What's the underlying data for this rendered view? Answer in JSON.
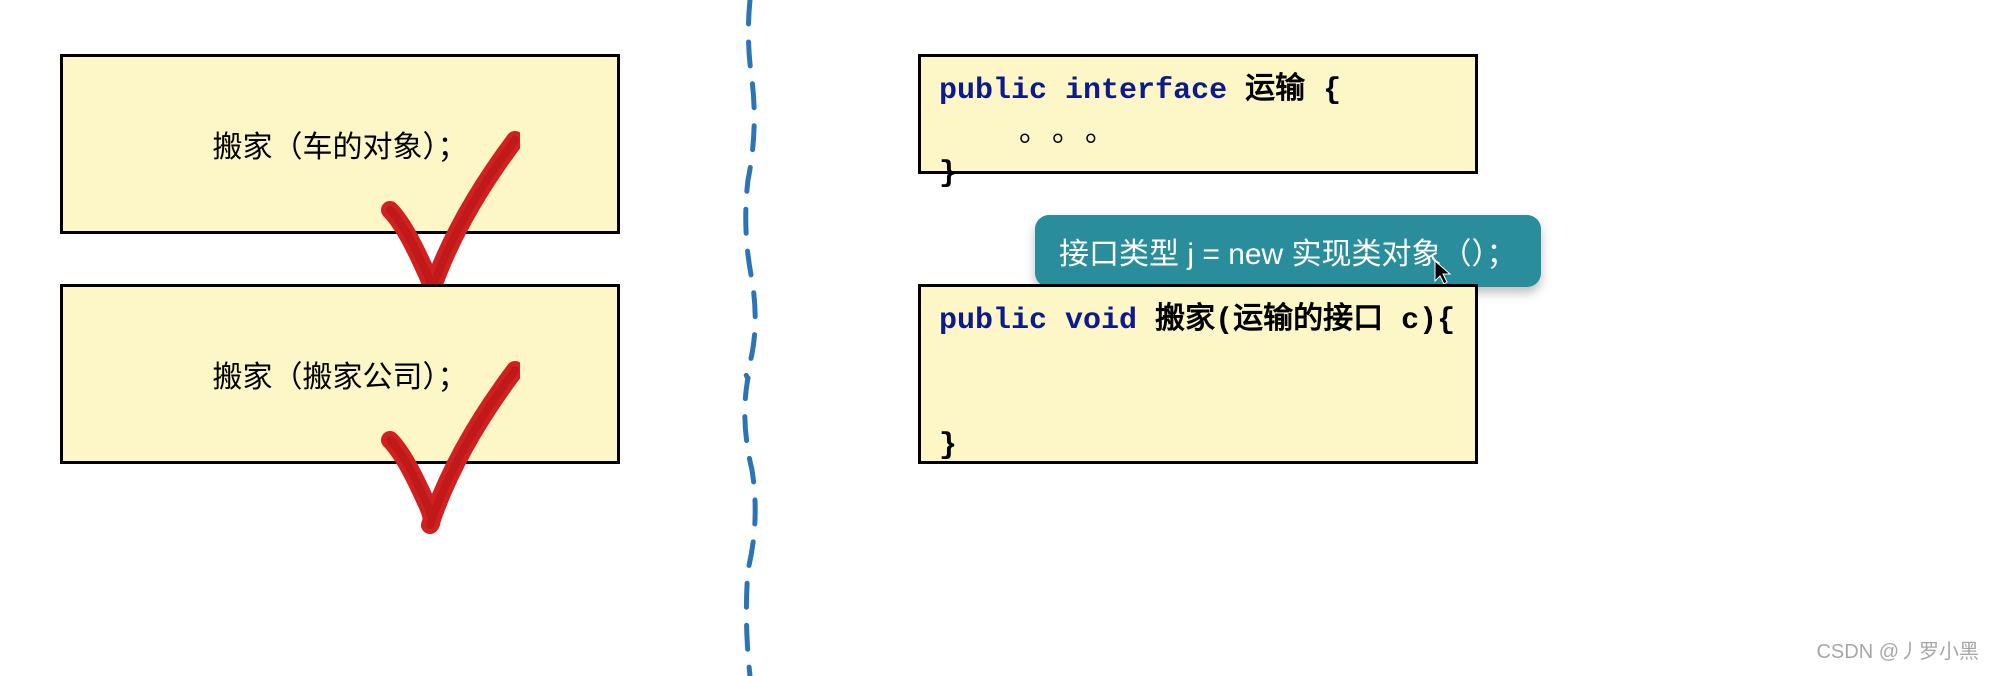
{
  "left": {
    "box1_text": "搬家（车的对象）；",
    "box2_text": "搬家（搬家公司）；"
  },
  "right": {
    "interface_decl_kw1": "public",
    "interface_decl_kw2": "interface",
    "interface_decl_name": "运输 {",
    "interface_dots": "。。。",
    "interface_close": "}",
    "method_decl_kw1": "public",
    "method_decl_kw2": "void",
    "method_decl_rest": "搬家(运输的接口 c){",
    "method_close": "}"
  },
  "label": {
    "text": "接口类型 j = new 实现类对象（）；"
  },
  "watermark": "CSDN @丿罗小黑"
}
